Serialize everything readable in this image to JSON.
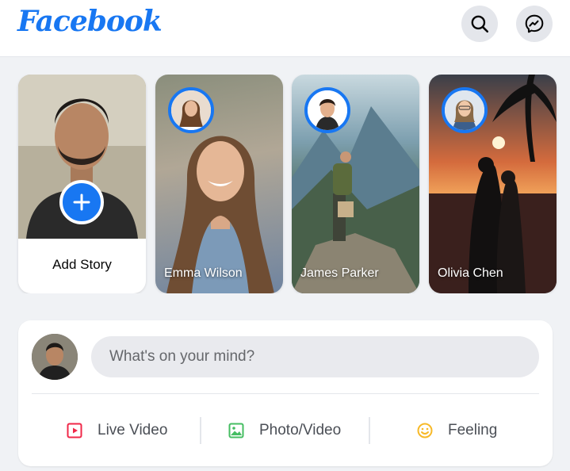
{
  "header": {
    "logo_text": "Facebook",
    "buttons": [
      "search-icon",
      "messenger-icon"
    ]
  },
  "stories": {
    "create": {
      "label": "Add Story",
      "icon": "plus-icon"
    },
    "items": [
      {
        "name": "Emma Wilson"
      },
      {
        "name": "James Parker"
      },
      {
        "name": "Olivia Chen"
      }
    ]
  },
  "composer": {
    "placeholder": "What's on your mind?",
    "actions": [
      {
        "label": "Live Video",
        "icon": "live-video-icon",
        "color": "#f02849"
      },
      {
        "label": "Photo/Video",
        "icon": "photo-icon",
        "color": "#45bd62"
      },
      {
        "label": "Feeling",
        "icon": "smile-icon",
        "color": "#f7b928"
      }
    ]
  },
  "colors": {
    "brand": "#1877f2",
    "background": "#f0f2f5"
  }
}
